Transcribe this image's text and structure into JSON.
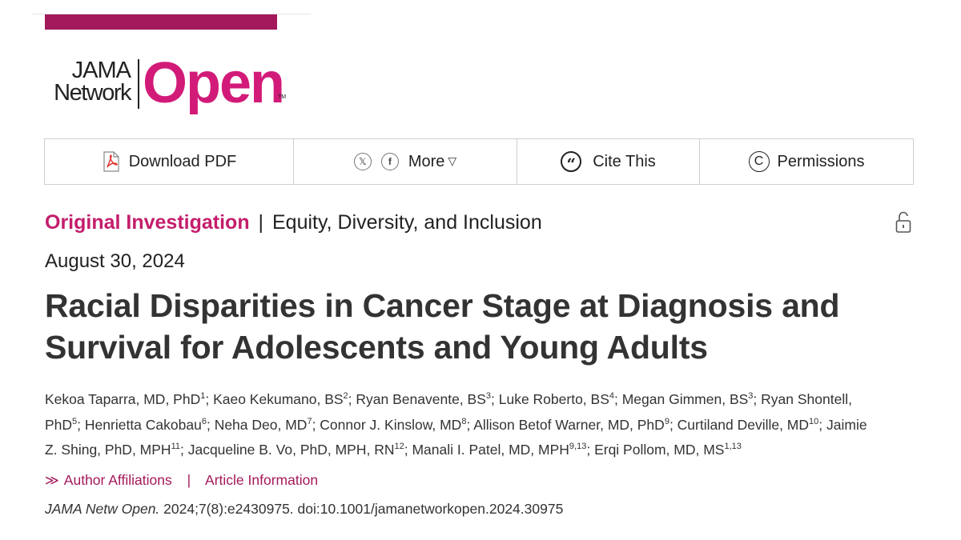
{
  "colors": {
    "brand": "#a3195b",
    "accent": "#d21b79",
    "text": "#333333",
    "border": "#cfcfcf"
  },
  "logo": {
    "line1": "JAMA",
    "line2": "Network",
    "word": "Open",
    "tm": "TM"
  },
  "toolbar": {
    "download": {
      "icon": "pdf-icon",
      "label": "Download PDF"
    },
    "share": {
      "x_icon": "x-social-icon",
      "x_glyph": "𝕏",
      "fb_icon": "facebook-icon",
      "fb_glyph": "f",
      "label": "More",
      "caret": "▽"
    },
    "cite": {
      "icon": "quote-icon",
      "glyph": "“",
      "label": "Cite This"
    },
    "permissions": {
      "icon": "copyright-icon",
      "glyph": "C",
      "label": "Permissions"
    }
  },
  "article": {
    "type": "Original Investigation",
    "separator": "|",
    "section": "Equity, Diversity, and Inclusion",
    "access_icon": "unlock-icon",
    "date": "August 30, 2024",
    "title_line1": "Racial Disparities in Cancer Stage at Diagnosis and",
    "title_line2": "Survival for Adolescents and Young Adults"
  },
  "authors": [
    {
      "name": "Kekoa Taparra, MD, PhD",
      "sup": "1"
    },
    {
      "name": "Kaeo Kekumano, BS",
      "sup": "2"
    },
    {
      "name": "Ryan Benavente, BS",
      "sup": "3"
    },
    {
      "name": "Luke Roberto, BS",
      "sup": "4"
    },
    {
      "name": "Megan Gimmen, BS",
      "sup": "3"
    },
    {
      "name": "Ryan Shontell, PhD",
      "sup": "5"
    },
    {
      "name": "Henrietta Cakobau",
      "sup": "6"
    },
    {
      "name": "Neha Deo, MD",
      "sup": "7"
    },
    {
      "name": "Connor J. Kinslow, MD",
      "sup": "8"
    },
    {
      "name": "Allison Betof Warner, MD, PhD",
      "sup": "9"
    },
    {
      "name": "Curtiland Deville, MD",
      "sup": "10"
    },
    {
      "name": "Jaimie Z. Shing, PhD, MPH",
      "sup": "11"
    },
    {
      "name": "Jacqueline B. Vo, PhD, MPH, RN",
      "sup": "12"
    },
    {
      "name": "Manali I. Patel, MD, MPH",
      "sup": "9,13"
    },
    {
      "name": "Erqi Pollom, MD, MS",
      "sup": "1,13"
    }
  ],
  "links": {
    "chevron": "≫",
    "affiliations": "Author Affiliations",
    "separator": "|",
    "info": "Article Information"
  },
  "citation": {
    "journal": "JAMA Netw Open.",
    "details": " 2024;7(8):e2430975. doi:10.1001/jamanetworkopen.2024.30975"
  }
}
